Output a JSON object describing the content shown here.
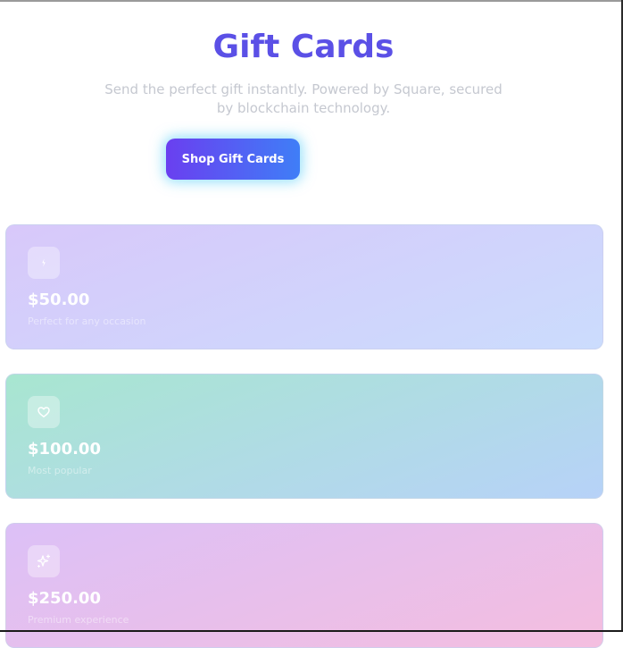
{
  "header": {
    "title": "Gift Cards",
    "subtitle": "Send the perfect gift instantly. Powered by Square, secured by blockchain technology.",
    "cta_label": "Shop Gift Cards"
  },
  "cards": [
    {
      "amount": "$50.00",
      "description": "Perfect for any occasion",
      "icon": "lightning-icon"
    },
    {
      "amount": "$100.00",
      "description": "Most popular",
      "icon": "heart-icon"
    },
    {
      "amount": "$250.00",
      "description": "Premium experience",
      "icon": "sparkles-icon"
    }
  ],
  "colors": {
    "title": "#5b50e6",
    "button_start": "#6a3ff0",
    "button_end": "#3f7ef7",
    "button_glow": "#46c8f5"
  }
}
